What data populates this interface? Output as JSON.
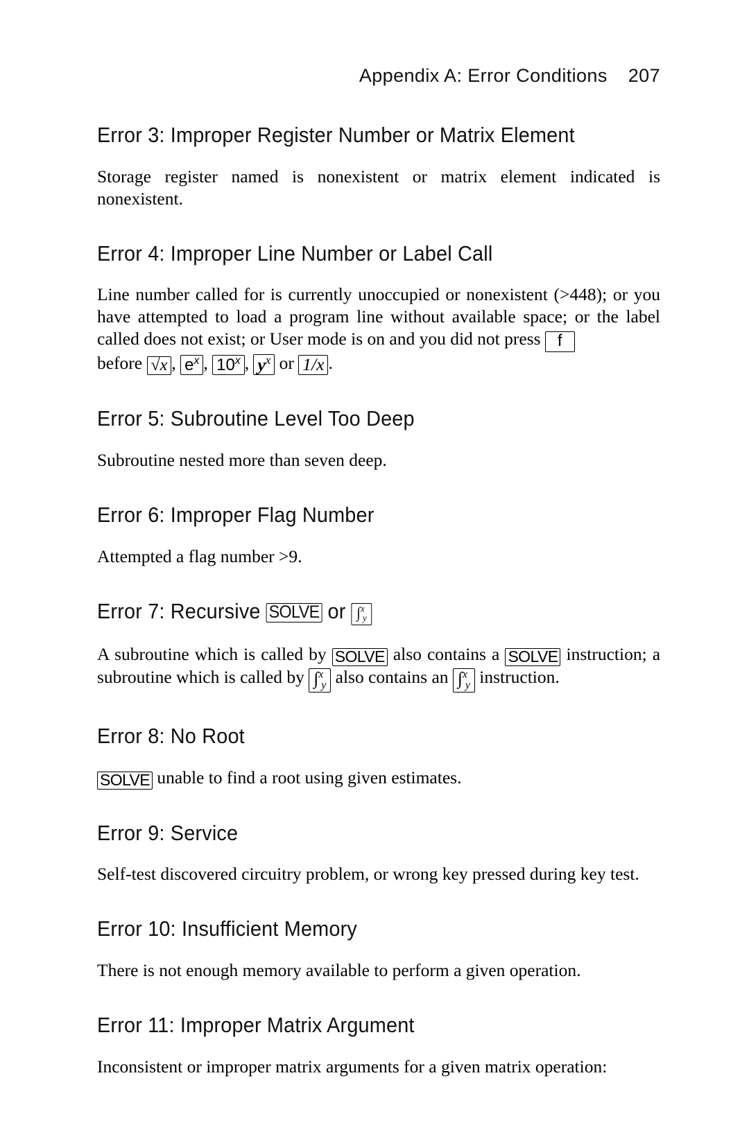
{
  "header": {
    "title": "Appendix A: Error Conditions",
    "page_number": "207"
  },
  "sections": [
    {
      "id": "error-3",
      "heading_prefix": "Error 3:",
      "heading": "Error 3:  Improper Register Number or Matrix Element",
      "body": "Storage register named is nonexistent or matrix element indicated is nonexistent."
    },
    {
      "id": "error-4",
      "heading_prefix": "Error 4:",
      "heading": "Error 4:  Improper Line Number or Label Call",
      "body_part_1": "Line number called for is currently unoccupied or nonexistent (>448); or you have attempted to load a program line without available space; or the label called does not exist; or User mode is on and you did not press",
      "key_f": "f",
      "body_part_2": "before",
      "key_sqrt": "√x",
      "key_ex": "e",
      "key_ex_sup": "x",
      "key_10x": "10",
      "key_10x_sup": "x",
      "key_yx": "y",
      "key_yx_sup": "x",
      "sep_comma": ",",
      "body_or": "or",
      "key_recip": "1/x",
      "body_end": "."
    },
    {
      "id": "error-5",
      "heading": "Error 5: Subroutine Level Too Deep",
      "body": "Subroutine nested more than seven deep."
    },
    {
      "id": "error-6",
      "heading": "Error 6:  Improper Flag Number",
      "body": "Attempted a flag number >9."
    },
    {
      "id": "error-7",
      "heading_a": "Error 7:  Recursive",
      "heading_key_solve": "SOLVE",
      "heading_b": "or",
      "heading_key_integral": "∫",
      "body_a": "A subroutine which is called by",
      "body_key_solve_1": "SOLVE",
      "body_b": "also contains a",
      "body_key_solve_2": "SOLVE",
      "body_c": "instruction; a subroutine which is called by",
      "body_d": "also contains an",
      "body_e": "instruction."
    },
    {
      "id": "error-8",
      "heading": "Error 8: No Root",
      "body_key_solve": "SOLVE",
      "body": "unable to find a root using given estimates."
    },
    {
      "id": "error-9",
      "heading": "Error 9: Service",
      "body": "Self-test discovered circuitry problem, or wrong key pressed during key test."
    },
    {
      "id": "error-10",
      "heading": "Error 10: Insufficient Memory",
      "body": "There is not enough memory available to perform a given operation."
    },
    {
      "id": "error-11",
      "heading": "Error 11: Improper Matrix Argument",
      "body": "Inconsistent or improper matrix arguments for a given matrix operation:"
    }
  ],
  "key_glyphs": {
    "f": "f",
    "sqrt_x": "sqrt-x",
    "e_to_x": "e-to-the-x",
    "ten_to_x": "ten-to-the-x",
    "y_to_x": "y-to-the-x",
    "reciprocal": "one-over-x",
    "solve": "SOLVE",
    "integral": "integral-f-y-x"
  }
}
